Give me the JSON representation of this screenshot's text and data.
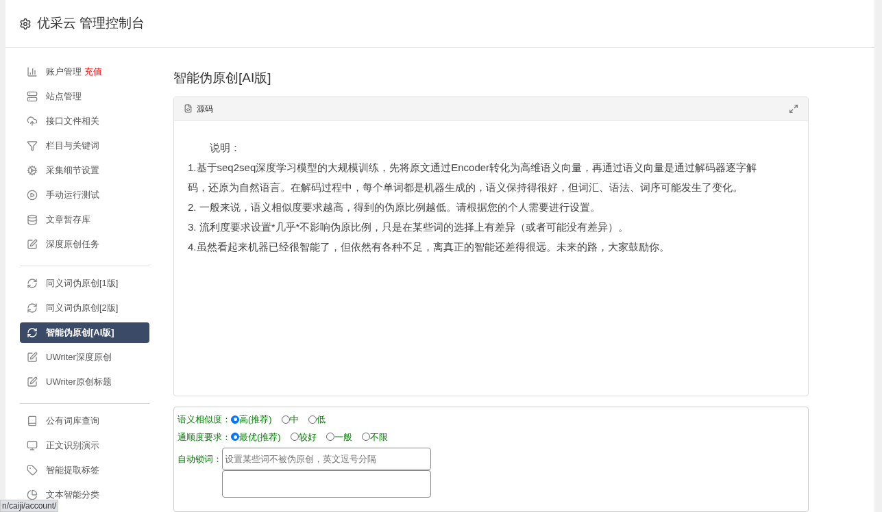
{
  "header": {
    "title": "优采云 管理控制台"
  },
  "sidebar": {
    "groups": [
      {
        "items": [
          {
            "kind": "bar-chart",
            "label": "账户管理",
            "badge": "充值",
            "selected": false
          },
          {
            "kind": "server",
            "label": "站点管理",
            "selected": false
          },
          {
            "kind": "cloud-upload",
            "label": "接口文件相关",
            "selected": false
          },
          {
            "kind": "filter",
            "label": "栏目与关键词",
            "selected": false
          },
          {
            "kind": "cogs",
            "label": "采集细节设置",
            "selected": false
          },
          {
            "kind": "play",
            "label": "手动运行测试",
            "selected": false
          },
          {
            "kind": "database",
            "label": "文章暂存库",
            "selected": false
          },
          {
            "kind": "edit",
            "label": "深度原创任务",
            "selected": false
          }
        ]
      },
      {
        "items": [
          {
            "kind": "refresh",
            "label": "同义词伪原创[1版]",
            "selected": false
          },
          {
            "kind": "refresh",
            "label": "同义词伪原创[2版]",
            "selected": false
          },
          {
            "kind": "refresh",
            "label": "智能伪原创[AI版]",
            "selected": true
          },
          {
            "kind": "edit",
            "label": "UWriter深度原创",
            "selected": false
          },
          {
            "kind": "edit",
            "label": "UWriter原创标题",
            "selected": false
          }
        ]
      },
      {
        "items": [
          {
            "kind": "book",
            "label": "公有词库查询",
            "selected": false
          },
          {
            "kind": "desktop",
            "label": "正文识别演示",
            "selected": false
          },
          {
            "kind": "tag",
            "label": "智能提取标签",
            "selected": false
          },
          {
            "kind": "pie",
            "label": "文本智能分类",
            "selected": false
          }
        ]
      }
    ]
  },
  "page_title": "智能伪原创[AI版]",
  "editor": {
    "tab": "源码",
    "lines": [
      "说明：",
      "1.基于seq2seq深度学习模型的大规模训练，先将原文通过Encoder转化为高维语义向量，再通过语义向量是通过解码器逐字解码，还原为自然语言。在解码过程中，每个单词都是机器生成的，语义保持得很好，但词汇、语法、词序可能发生了变化。",
      "2. 一般来说，语义相似度要求越高，得到的伪原比例越低。请根据您的个人需要进行设置。",
      "3. 流利度要求设置*几乎*不影响伪原比例，只是在某些词的选择上有差异（或者可能没有差异）。",
      "4.虽然看起来机器已经很智能了，但依然有各种不足，离真正的智能还差得很远。未来的路，大家鼓励你。"
    ]
  },
  "options": [
    {
      "kind": "radio",
      "label": "语义相似度：",
      "choices": [
        {
          "label": "高(推荐)",
          "selected": true
        },
        {
          "label": "中",
          "selected": false
        },
        {
          "label": "低",
          "selected": false
        }
      ]
    },
    {
      "kind": "radio",
      "label": "通顺度要求：",
      "choices": [
        {
          "label": "最优(推荐)",
          "selected": true
        },
        {
          "label": "较好",
          "selected": false
        },
        {
          "label": "一般",
          "selected": false
        },
        {
          "label": "不限",
          "selected": false
        }
      ]
    },
    {
      "kind": "text",
      "label": "自动锁词：",
      "placeholder": "设置某些词不被伪原创，英文逗号分隔"
    }
  ],
  "status_url": "n/caiji/account/"
}
